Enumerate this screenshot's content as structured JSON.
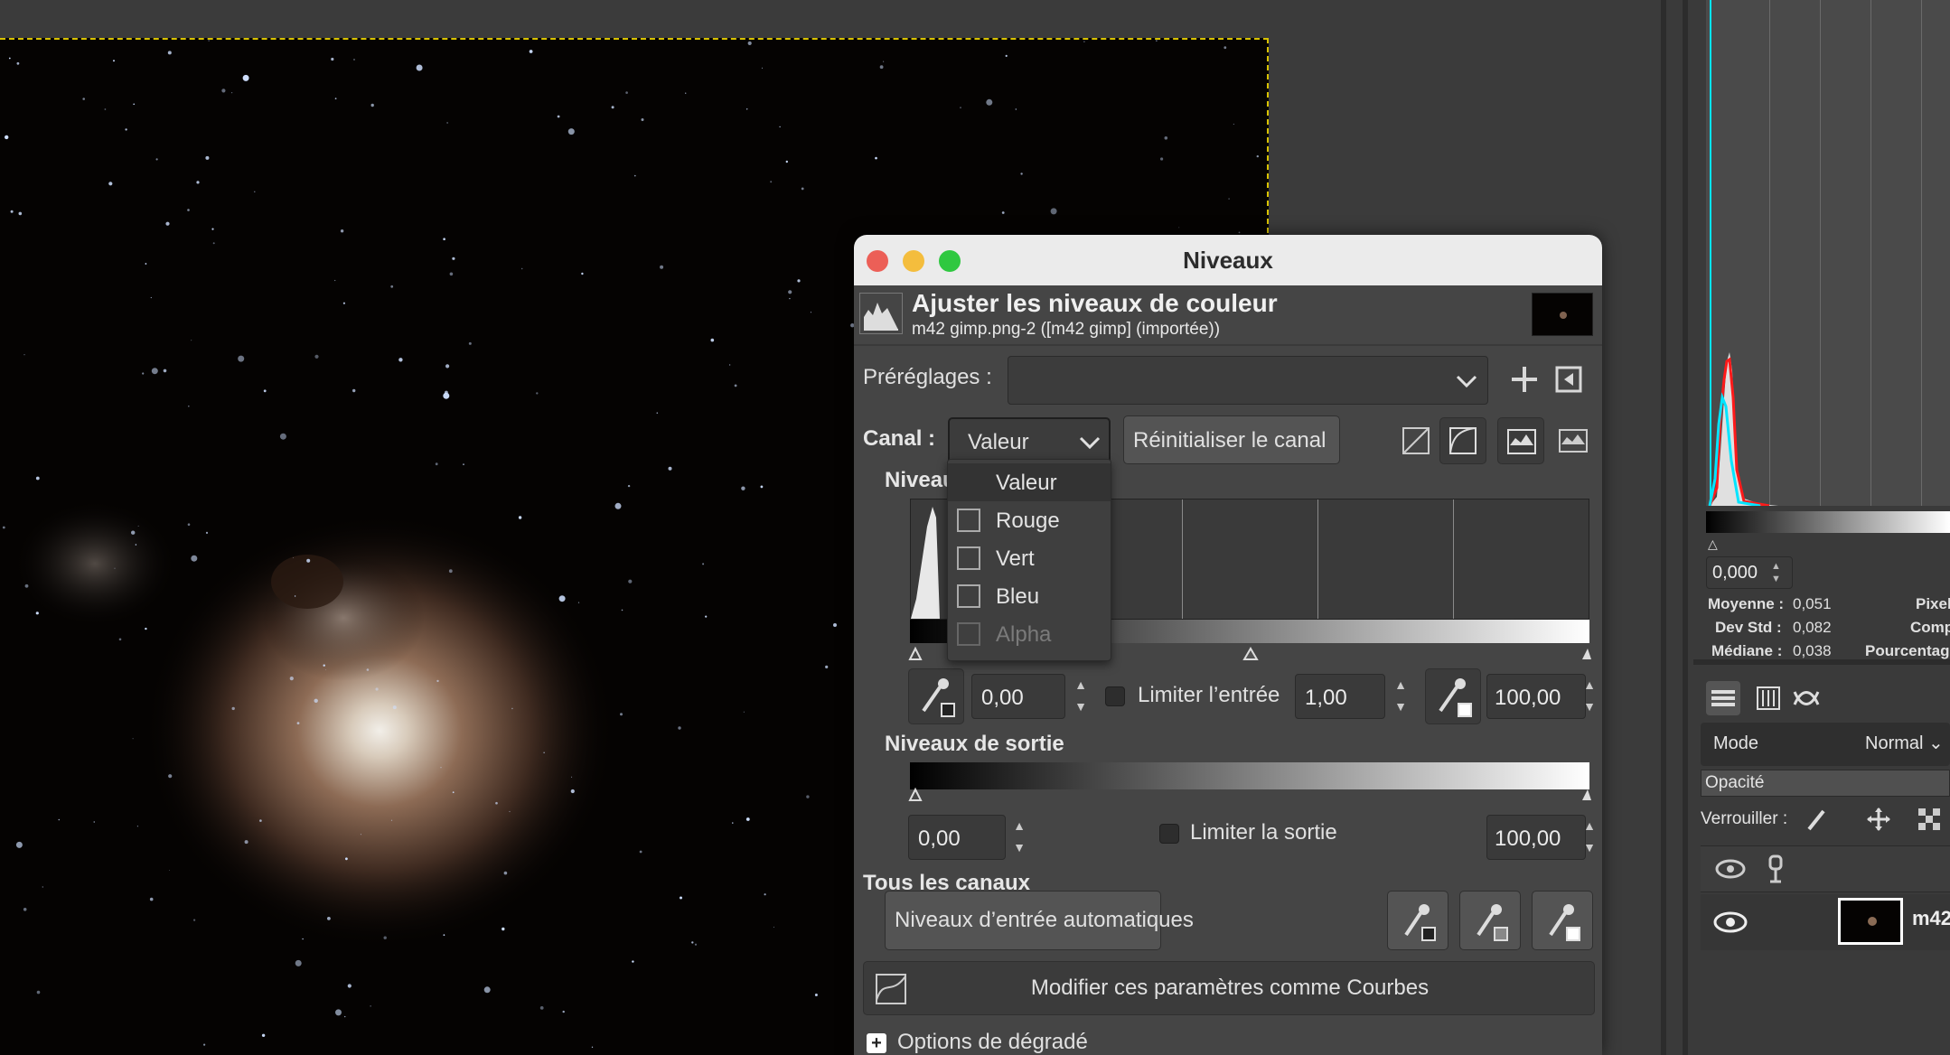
{
  "dialog": {
    "window_title": "Niveaux",
    "header_title": "Ajuster les niveaux de couleur",
    "header_subtitle": "m42 gimp.png-2 ([m42 gimp] (importée))",
    "presets_label": "Préréglages :",
    "presets_value": "",
    "channel_label": "Canal :",
    "channel_value": "Valeur",
    "reset_channel_label": "Réinitialiser le canal",
    "input_levels_label": "Niveau",
    "input_low": "0,00",
    "clamp_input_label": "Limiter l’entrée",
    "input_gamma": "1,00",
    "input_high": "100,00",
    "output_levels_label": "Niveaux de sortie",
    "output_low": "0,00",
    "clamp_output_label": "Limiter la sortie",
    "output_high": "100,00",
    "all_channels_label": "Tous les canaux",
    "auto_input_label": "Niveaux d’entrée automatiques",
    "edit_as_curves_label": "Modifier ces paramètres comme Courbes",
    "gradient_options_label": "Options de dégradé"
  },
  "channel_menu": {
    "items": [
      {
        "label": "Valeur",
        "enabled": true,
        "selected": true
      },
      {
        "label": "Rouge",
        "enabled": true,
        "selected": false
      },
      {
        "label": "Vert",
        "enabled": true,
        "selected": false
      },
      {
        "label": "Bleu",
        "enabled": true,
        "selected": false
      },
      {
        "label": "Alpha",
        "enabled": false,
        "selected": false
      }
    ]
  },
  "histogram_panel": {
    "value": "0,000",
    "mean_label": "Moyenne :",
    "mean_value": "0,051",
    "stddev_label": "Dev Std :",
    "stddev_value": "0,082",
    "median_label": "Médiane :",
    "median_value": "0,038",
    "pixels_label": "Pixel",
    "count_label": "Compt",
    "percent_label": "Pourcentag"
  },
  "layers_panel": {
    "mode_label": "Mode",
    "mode_value": "Normal",
    "opacity_label": "Opacité",
    "lock_label": "Verrouiller :",
    "layer_name": "m42"
  },
  "colors": {
    "image_border": "#d8c200",
    "dialog_bg": "#454545",
    "close": "#ec5f57",
    "minimize": "#f4bd3d",
    "maximize": "#2fc840"
  }
}
